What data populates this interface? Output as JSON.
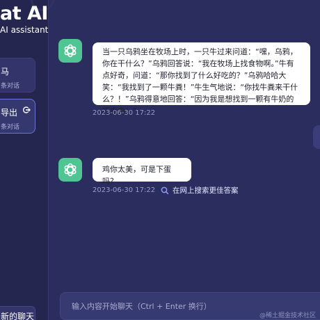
{
  "sidebar": {
    "brand_title": "at AI",
    "brand_subtitle": "AI assistant",
    "conversations": [
      {
        "title": "马",
        "subtitle": "条对话",
        "active": false
      },
      {
        "title": "导出",
        "subtitle": "条对话",
        "active": true
      }
    ],
    "new_chat_label": "新的聊天"
  },
  "messages": [
    {
      "role": "assistant",
      "text": "当一只乌鸦坐在牧场上时，一只牛过来问道：“嘿，乌鸦，你在干什么？”乌鸦回答说：“我在牧场上找食物啊。”牛有点好奇，问道：“那你找到了什么好吃的？”乌鸦哈哈大笑：“我找到了一颗牛粪！”牛生气地说：“你找牛粪来干什么？！”乌鸦得意地回答：“因为我是想找到一颗有牛奶的巧克力！”",
      "time": "2023-06-30 17:22"
    },
    {
      "role": "assistant",
      "text": "鸡你太美，可是下蛋吗？",
      "time": "2023-06-30 17:22",
      "search_label": "在网上搜索更佳答案"
    }
  ],
  "input": {
    "placeholder": "输入内容开始聊天（Ctrl + Enter 换行）",
    "value": ""
  },
  "watermark": "@稀土掘金技术社区",
  "colors": {
    "background": "#2b2d5e",
    "sidebar": "#24264f",
    "avatar": "#4ec592",
    "bubble": "#ffffff",
    "active_border": "#6c74d6"
  },
  "icons": {
    "avatar": "openai-logo-icon",
    "export": "export-icon",
    "search": "search-icon"
  }
}
